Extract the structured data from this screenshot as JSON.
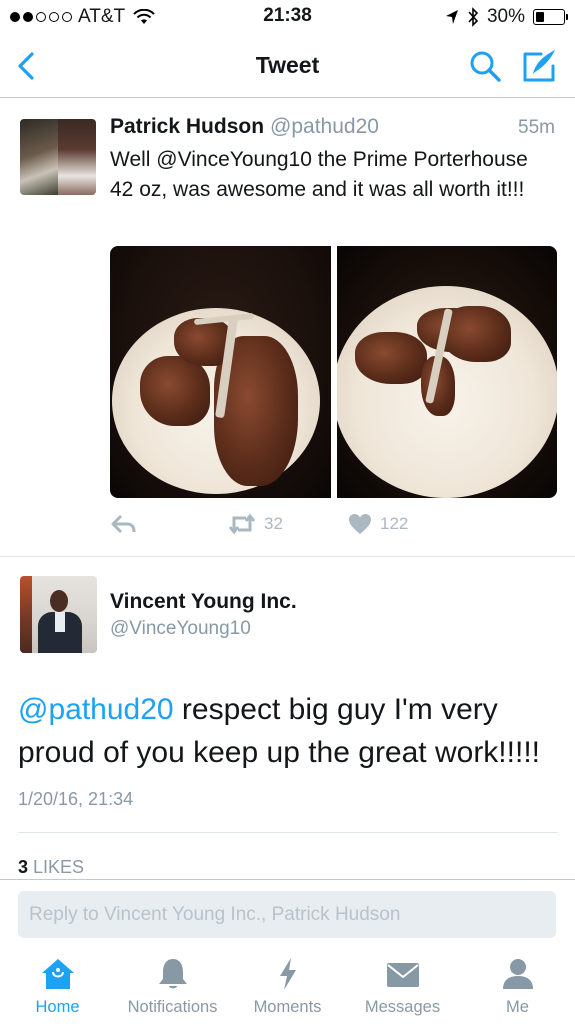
{
  "status_bar": {
    "carrier": "AT&T",
    "time": "21:38",
    "battery": "30%",
    "battery_level": 0.3
  },
  "nav": {
    "title": "Tweet",
    "back_icon": "chevron-left-icon",
    "search_icon": "search-icon",
    "compose_icon": "compose-icon"
  },
  "tweet1": {
    "name": "Patrick Hudson",
    "handle": "@pathud20",
    "time": "55m",
    "text": "Well @VinceYoung10 the Prime Porterhouse 42 oz, was awesome and it was all worth it!!!",
    "retweets": "32",
    "likes": "122"
  },
  "tweet2": {
    "name": "Vincent Young Inc.",
    "handle": "@VinceYoung10",
    "mention": "@pathud20",
    "text": " respect big guy I'm very proud of you keep up the great work!!!!!",
    "date": "1/20/16, 21:34",
    "likes_count": "3",
    "likes_label": "LIKES"
  },
  "reply": {
    "placeholder": "Reply to Vincent Young Inc., Patrick Hudson"
  },
  "tabbar": {
    "items": [
      {
        "label": "Home",
        "icon": "home-icon"
      },
      {
        "label": "Notifications",
        "icon": "bell-icon"
      },
      {
        "label": "Moments",
        "icon": "lightning-icon"
      },
      {
        "label": "Messages",
        "icon": "envelope-icon"
      },
      {
        "label": "Me",
        "icon": "person-icon"
      }
    ]
  },
  "colors": {
    "accent": "#1da1f2",
    "muted": "#8899a6",
    "action": "#aab8c2"
  }
}
